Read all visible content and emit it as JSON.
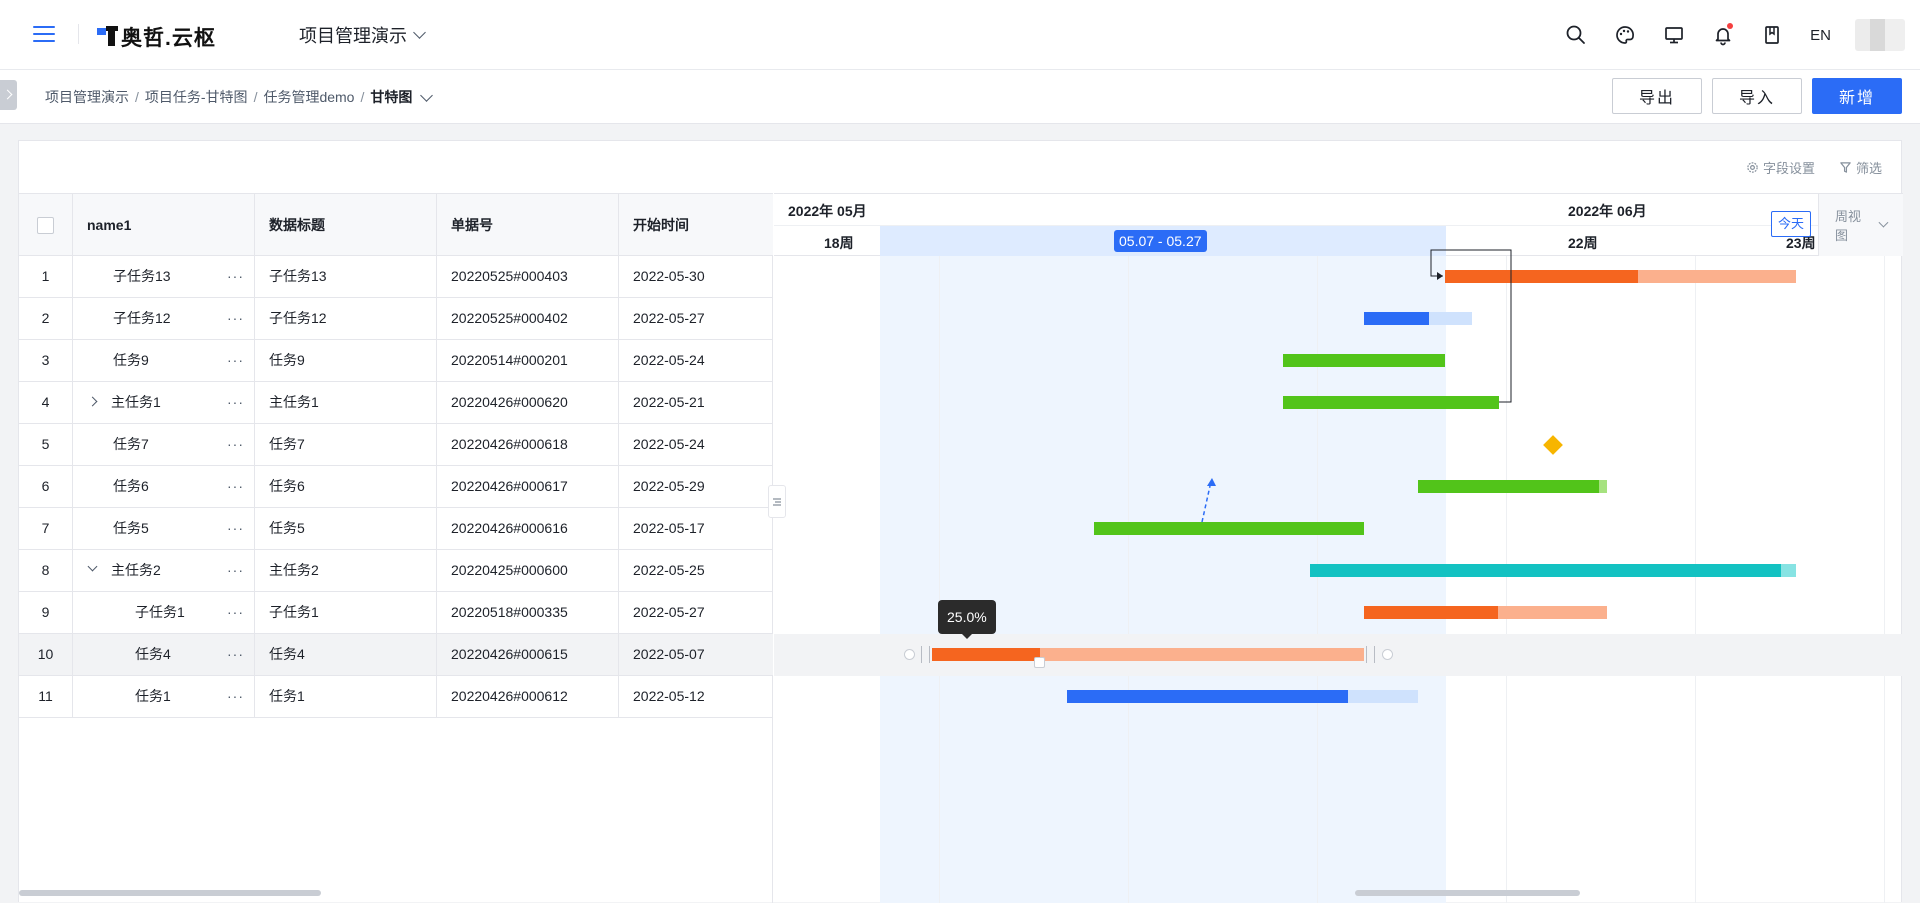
{
  "header": {
    "logo_text": "奥哲.云枢",
    "project": "项目管理演示",
    "lang": "EN",
    "icons": [
      "search-icon",
      "palette-icon",
      "monitor-icon",
      "bell-icon",
      "bookmark-icon"
    ]
  },
  "breadcrumb": {
    "items": [
      "项目管理演示",
      "项目任务-甘特图",
      "任务管理demo"
    ],
    "current": "甘特图"
  },
  "actions": {
    "export": "导出",
    "import": "导入",
    "add": "新增"
  },
  "toolbar": {
    "field_settings": "字段设置",
    "filter": "筛选"
  },
  "table": {
    "columns": [
      "name1",
      "数据标题",
      "单据号",
      "开始时间"
    ],
    "rows": [
      {
        "index": "1",
        "name": "子任务13",
        "title": "子任务13",
        "doc_no": "20220525#000403",
        "start": "2022-05-30",
        "level": 1,
        "expand": ""
      },
      {
        "index": "2",
        "name": "子任务12",
        "title": "子任务12",
        "doc_no": "20220525#000402",
        "start": "2022-05-27",
        "level": 1,
        "expand": ""
      },
      {
        "index": "3",
        "name": "任务9",
        "title": "任务9",
        "doc_no": "20220514#000201",
        "start": "2022-05-24",
        "level": 1,
        "expand": ""
      },
      {
        "index": "4",
        "name": "主任务1",
        "title": "主任务1",
        "doc_no": "20220426#000620",
        "start": "2022-05-21",
        "level": 0,
        "expand": "collapsed"
      },
      {
        "index": "5",
        "name": "任务7",
        "title": "任务7",
        "doc_no": "20220426#000618",
        "start": "2022-05-24",
        "level": 1,
        "expand": ""
      },
      {
        "index": "6",
        "name": "任务6",
        "title": "任务6",
        "doc_no": "20220426#000617",
        "start": "2022-05-29",
        "level": 1,
        "expand": ""
      },
      {
        "index": "7",
        "name": "任务5",
        "title": "任务5",
        "doc_no": "20220426#000616",
        "start": "2022-05-17",
        "level": 1,
        "expand": ""
      },
      {
        "index": "8",
        "name": "主任务2",
        "title": "主任务2",
        "doc_no": "20220425#000600",
        "start": "2022-05-25",
        "level": 0,
        "expand": "expanded"
      },
      {
        "index": "9",
        "name": "子任务1",
        "title": "子任务1",
        "doc_no": "20220518#000335",
        "start": "2022-05-27",
        "level": 2,
        "expand": ""
      },
      {
        "index": "10",
        "name": "任务4",
        "title": "任务4",
        "doc_no": "20220426#000615",
        "start": "2022-05-07",
        "level": 2,
        "expand": ""
      },
      {
        "index": "11",
        "name": "任务1",
        "title": "任务1",
        "doc_no": "20220426#000612",
        "start": "2022-05-12",
        "level": 2,
        "expand": ""
      }
    ],
    "more_label": "···"
  },
  "gantt": {
    "months": [
      "2022年 05月",
      "2022年 06月"
    ],
    "weeks": [
      "18周",
      "22周",
      "23周"
    ],
    "range_label": "05.07 - 05.27",
    "today_label": "今天",
    "view_label": "周视图",
    "tooltip": "25.0%",
    "colors": {
      "orange": "#f5651f",
      "orange_light": "#fbb08d",
      "blue": "#2b6cf6",
      "blue_light": "#cfe2fd",
      "green": "#52c41a",
      "green_light": "#a6e27f",
      "teal": "#13c2c2",
      "teal_light": "#87e3e3",
      "milestone": "#f7b500"
    },
    "bars": [
      {
        "row": 0,
        "start": "2022-05-30",
        "end": "2022-06-12",
        "progress": 0.55,
        "color": "orange"
      },
      {
        "row": 1,
        "start": "2022-05-27",
        "end": "2022-05-31",
        "progress": 0.6,
        "color": "blue"
      },
      {
        "row": 2,
        "start": "2022-05-24",
        "end": "2022-05-30",
        "progress": 1.0,
        "color": "green"
      },
      {
        "row": 3,
        "start": "2022-05-24",
        "end": "2022-06-01",
        "progress": 1.0,
        "color": "green"
      },
      {
        "row": 5,
        "start": "2022-05-29",
        "end": "2022-06-05",
        "progress": 0.96,
        "color": "green"
      },
      {
        "row": 6,
        "start": "2022-05-17",
        "end": "2022-05-27",
        "progress": 1.0,
        "color": "green"
      },
      {
        "row": 7,
        "start": "2022-05-25",
        "end": "2022-06-12",
        "progress": 0.97,
        "color": "teal"
      },
      {
        "row": 8,
        "start": "2022-05-27",
        "end": "2022-06-05",
        "progress": 0.55,
        "color": "orange"
      },
      {
        "row": 9,
        "start": "2022-05-11",
        "end": "2022-05-27",
        "progress": 0.25,
        "color": "orange"
      },
      {
        "row": 10,
        "start": "2022-05-16",
        "end": "2022-05-29",
        "progress": 0.8,
        "color": "blue"
      }
    ],
    "milestones": [
      {
        "row": 4,
        "date": "2022-06-03"
      }
    ]
  }
}
